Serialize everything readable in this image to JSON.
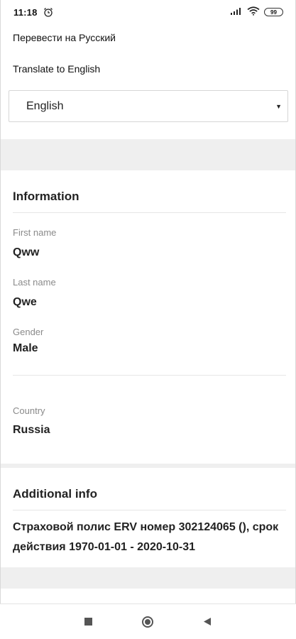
{
  "status_bar": {
    "time": "11:18",
    "battery": "99",
    "icons": [
      "alarm-icon",
      "signal-icon",
      "wifi-icon",
      "battery-icon"
    ]
  },
  "translate": {
    "to_russian": "Перевести на Русский",
    "to_english": "Translate to English"
  },
  "language_select": {
    "selected": "English"
  },
  "information": {
    "title": "Information",
    "fields": [
      {
        "label": "First name",
        "value": "Qww"
      },
      {
        "label": "Last name",
        "value": "Qwe"
      },
      {
        "label": "Gender",
        "value": "Male"
      },
      {
        "label": "Country",
        "value": "Russia"
      }
    ]
  },
  "additional_info": {
    "title": "Additional info",
    "text": "Страховой полис ERV номер 302124065 (), срок действия 1970-01-01 - 2020-10-31"
  },
  "nav_bar": {
    "icons": [
      "recent-apps-icon",
      "home-icon",
      "back-icon"
    ]
  },
  "colors": {
    "band": "#efefef",
    "label": "#8a8a8a",
    "text": "#222222"
  }
}
